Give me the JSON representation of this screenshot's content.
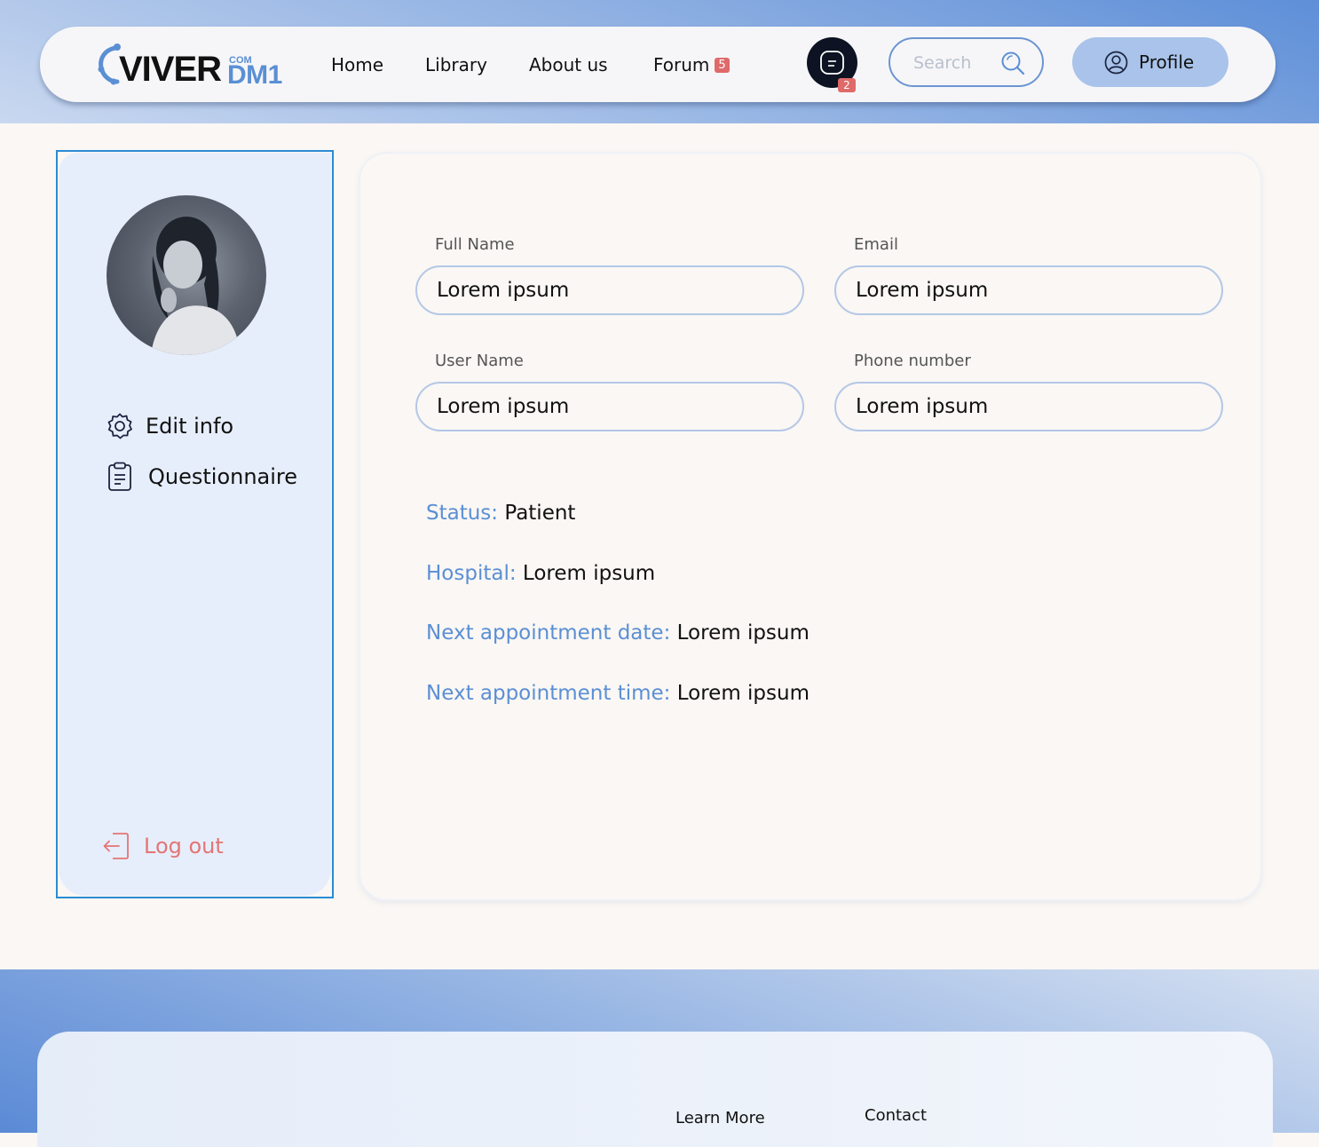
{
  "brand": {
    "logo_main": "VIVER",
    "logo_suffix": "DM1",
    "logo_small": "COM"
  },
  "nav": {
    "home": "Home",
    "library": "Library",
    "about": "About us",
    "forum": "Forum",
    "forum_badge": "5",
    "chat_badge": "2"
  },
  "search": {
    "placeholder": "Search"
  },
  "profile": {
    "label": "Profile"
  },
  "sidebar": {
    "edit_info": "Edit info",
    "questionnaire": "Questionnaire",
    "logout": "Log out"
  },
  "form": {
    "full_name_label": "Full Name",
    "full_name_value": "Lorem ipsum",
    "email_label": "Email",
    "email_value": "Lorem ipsum",
    "user_name_label": "User Name",
    "user_name_value": "Lorem ipsum",
    "phone_label": "Phone number",
    "phone_value": "Lorem ipsum"
  },
  "info": {
    "status_key": "Status:",
    "status_val": "Patient",
    "hospital_key": "Hospital:",
    "hospital_val": "Lorem ipsum",
    "next_date_key": "Next appointment date:",
    "next_date_val": "Lorem ipsum",
    "next_time_key": "Next appointment time:",
    "next_time_val": "Lorem ipsum"
  },
  "footer": {
    "learn_more": "Learn More",
    "contact": "Contact"
  },
  "colors": {
    "accent": "#5b8fd4",
    "danger": "#e37575",
    "profile_button": "#a9c3ea",
    "chat_button": "#0d1322"
  },
  "icons": {
    "settings": "gear-icon",
    "questionnaire": "clipboard-icon",
    "logout": "logout-icon",
    "search": "search-icon",
    "profile": "user-circle-icon",
    "chat": "chat-icon"
  }
}
